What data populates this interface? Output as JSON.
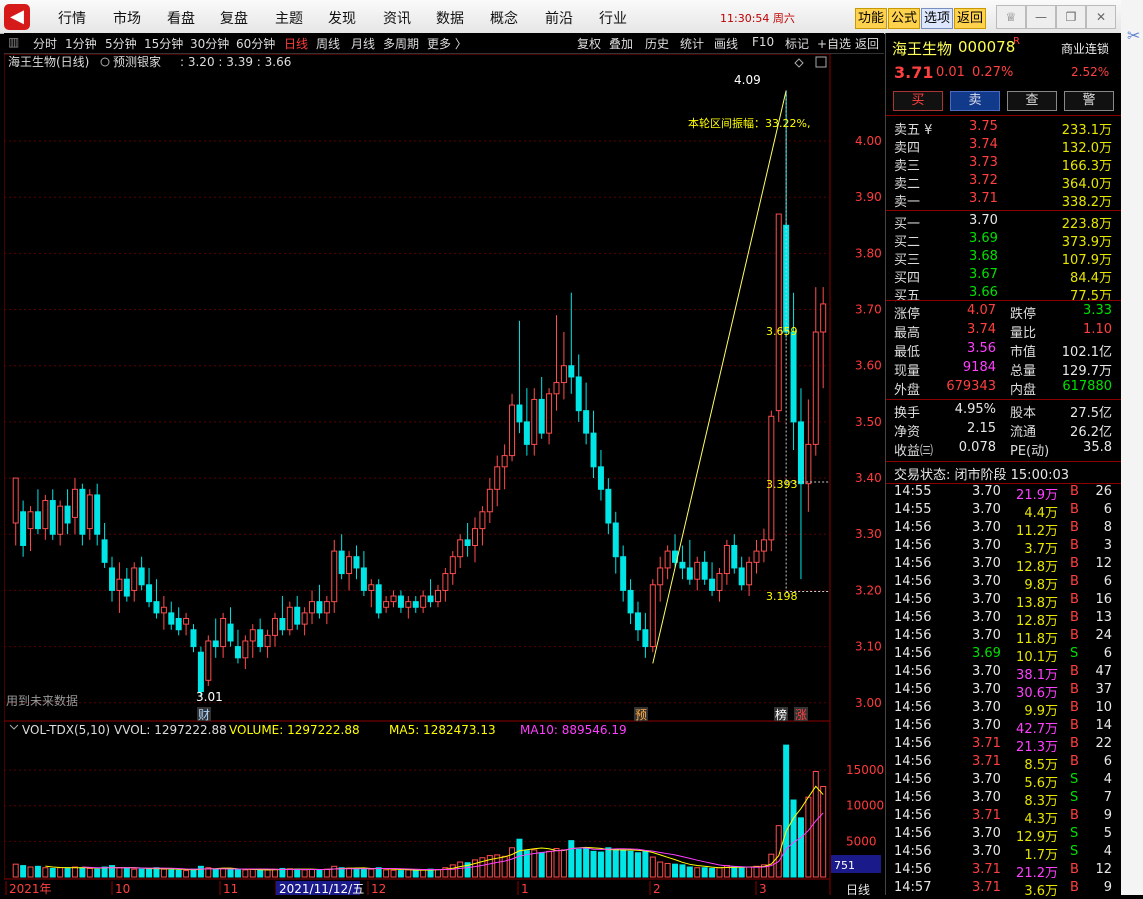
{
  "menu": [
    "行情",
    "市场",
    "看盘",
    "复盘",
    "主题",
    "发现",
    "资讯",
    "数据",
    "概念",
    "前沿",
    "行业"
  ],
  "clock": "11:30:54 周六",
  "sys_buttons": [
    "功能",
    "公式",
    "选项",
    "返回"
  ],
  "periods": [
    "分时",
    "1分钟",
    "5分钟",
    "15分钟",
    "30分钟",
    "60分钟",
    "日线",
    "周线",
    "月线",
    "多周期",
    "更多 〉"
  ],
  "active_period": "日线",
  "tools": [
    "复权",
    "叠加",
    "历史",
    "统计",
    "画线",
    "F10",
    "标记",
    "+自选",
    "返回"
  ],
  "chart_header": {
    "title": "海王生物(日线)",
    "indicator": "预测银家",
    "values": ": 3.20 : 3.39 : 3.66"
  },
  "annotations": {
    "high": "4.09",
    "amplitude": "本轮区间振幅：33.22%,",
    "mid1": "3.659",
    "mid2": "3.393",
    "low_mark": "3.198",
    "low_left": "3.01",
    "future_note": "用到未来数据",
    "marker_cai": "财",
    "marker_yu": "预",
    "marker_bang": "榜",
    "marker_zhang": "涨"
  },
  "volume_header": {
    "name": "VOL-TDX(5,10)",
    "vvol": "VVOL: 1297222.88",
    "volume": "VOLUME: 1297222.88",
    "ma5": "MA5: 1282473.13",
    "ma10": "MA10: 889546.19"
  },
  "volume_axis_extra": "751",
  "x_labels": [
    "2021年",
    "10",
    "11",
    "2021/11/12/五",
    "12",
    "1",
    "2",
    "3"
  ],
  "period_label": "日线",
  "stock": {
    "name": "海王生物",
    "code": "000078",
    "flag": "R",
    "tag": "商业连锁",
    "price": "3.71",
    "change": "0.01",
    "pct": "0.27%",
    "amp": "2.52%"
  },
  "trade_buttons": [
    "买",
    "卖",
    "查",
    "警"
  ],
  "asks": [
    [
      "卖五 ¥",
      "3.75",
      "233.1万"
    ],
    [
      "卖四",
      "3.74",
      "132.0万"
    ],
    [
      "卖三",
      "3.73",
      "166.3万"
    ],
    [
      "卖二",
      "3.72",
      "364.0万"
    ],
    [
      "卖一",
      "3.71",
      "338.2万"
    ]
  ],
  "bids": [
    [
      "买一",
      "3.70",
      "223.8万"
    ],
    [
      "买二",
      "3.69",
      "373.9万"
    ],
    [
      "买三",
      "3.68",
      "107.9万"
    ],
    [
      "买四",
      "3.67",
      "84.4万"
    ],
    [
      "买五",
      "3.66",
      "77.5万"
    ]
  ],
  "stats": [
    [
      "涨停",
      "4.07",
      "跌停",
      "3.33"
    ],
    [
      "最高",
      "3.74",
      "量比",
      "1.10"
    ],
    [
      "最低",
      "3.56",
      "市值",
      "102.1亿"
    ],
    [
      "现量",
      "9184",
      "总量",
      "129.7万"
    ],
    [
      "外盘",
      "679343",
      "内盘",
      "617880"
    ]
  ],
  "stats2": [
    [
      "换手",
      "4.95%",
      "股本",
      "27.5亿"
    ],
    [
      "净资",
      "2.15",
      "流通",
      "26.2亿"
    ],
    [
      "收益㈢",
      "0.078",
      "PE(动)",
      "35.8"
    ]
  ],
  "status": "交易状态: 闭市阶段 15:00:03",
  "ticks": [
    [
      "14:55",
      "3.70",
      "21.9万",
      "B",
      "26"
    ],
    [
      "14:55",
      "3.70",
      "4.4万",
      "B",
      "6"
    ],
    [
      "14:56",
      "3.70",
      "11.2万",
      "B",
      "8"
    ],
    [
      "14:56",
      "3.70",
      "3.7万",
      "B",
      "3"
    ],
    [
      "14:56",
      "3.70",
      "12.8万",
      "B",
      "12"
    ],
    [
      "14:56",
      "3.70",
      "9.8万",
      "B",
      "6"
    ],
    [
      "14:56",
      "3.70",
      "13.8万",
      "B",
      "16"
    ],
    [
      "14:56",
      "3.70",
      "12.8万",
      "B",
      "13"
    ],
    [
      "14:56",
      "3.70",
      "11.8万",
      "B",
      "24"
    ],
    [
      "14:56",
      "3.69",
      "10.1万",
      "S",
      "6"
    ],
    [
      "14:56",
      "3.70",
      "38.1万",
      "B",
      "47"
    ],
    [
      "14:56",
      "3.70",
      "30.6万",
      "B",
      "37"
    ],
    [
      "14:56",
      "3.70",
      "9.9万",
      "B",
      "10"
    ],
    [
      "14:56",
      "3.70",
      "42.7万",
      "B",
      "14"
    ],
    [
      "14:56",
      "3.71",
      "21.3万",
      "B",
      "22"
    ],
    [
      "14:56",
      "3.71",
      "8.5万",
      "B",
      "6"
    ],
    [
      "14:56",
      "3.70",
      "5.6万",
      "S",
      "4"
    ],
    [
      "14:56",
      "3.70",
      "8.3万",
      "S",
      "7"
    ],
    [
      "14:56",
      "3.71",
      "4.3万",
      "B",
      "9"
    ],
    [
      "14:56",
      "3.70",
      "12.9万",
      "S",
      "5"
    ],
    [
      "14:56",
      "3.70",
      "1.7万",
      "S",
      "4"
    ],
    [
      "14:56",
      "3.71",
      "21.2万",
      "B",
      "12"
    ],
    [
      "14:57",
      "3.71",
      "3.6万",
      "B",
      "9"
    ]
  ],
  "chart_data": {
    "type": "candlestick",
    "price_axis": [
      "4.00",
      "3.90",
      "3.80",
      "3.70",
      "3.60",
      "3.50",
      "3.40",
      "3.30",
      "3.20",
      "3.10",
      "3.00"
    ],
    "ylim": [
      2.98,
      4.13
    ],
    "volume_axis": [
      "15000",
      "10000",
      "5000"
    ],
    "vol_max": 19500,
    "candles": [
      [
        3.32,
        3.4,
        3.28,
        3.4
      ],
      [
        3.34,
        3.36,
        3.26,
        3.28
      ],
      [
        3.31,
        3.35,
        3.27,
        3.34
      ],
      [
        3.34,
        3.38,
        3.3,
        3.31
      ],
      [
        3.31,
        3.37,
        3.29,
        3.36
      ],
      [
        3.36,
        3.38,
        3.29,
        3.3
      ],
      [
        3.3,
        3.36,
        3.28,
        3.35
      ],
      [
        3.35,
        3.38,
        3.3,
        3.32
      ],
      [
        3.33,
        3.4,
        3.3,
        3.38
      ],
      [
        3.38,
        3.39,
        3.28,
        3.3
      ],
      [
        3.31,
        3.38,
        3.29,
        3.37
      ],
      [
        3.37,
        3.39,
        3.28,
        3.3
      ],
      [
        3.29,
        3.32,
        3.24,
        3.25
      ],
      [
        3.24,
        3.26,
        3.18,
        3.2
      ],
      [
        3.2,
        3.25,
        3.16,
        3.22
      ],
      [
        3.22,
        3.24,
        3.18,
        3.19
      ],
      [
        3.2,
        3.25,
        3.18,
        3.24
      ],
      [
        3.24,
        3.26,
        3.2,
        3.21
      ],
      [
        3.21,
        3.24,
        3.17,
        3.18
      ],
      [
        3.18,
        3.22,
        3.15,
        3.16
      ],
      [
        3.16,
        3.19,
        3.13,
        3.17
      ],
      [
        3.16,
        3.18,
        3.13,
        3.14
      ],
      [
        3.15,
        3.17,
        3.12,
        3.13
      ],
      [
        3.14,
        3.16,
        3.12,
        3.15
      ],
      [
        3.13,
        3.14,
        3.09,
        3.1
      ],
      [
        3.09,
        3.1,
        3.01,
        3.02
      ],
      [
        3.04,
        3.12,
        3.03,
        3.11
      ],
      [
        3.11,
        3.15,
        3.08,
        3.1
      ],
      [
        3.1,
        3.16,
        3.08,
        3.15
      ],
      [
        3.14,
        3.17,
        3.1,
        3.11
      ],
      [
        3.1,
        3.13,
        3.07,
        3.08
      ],
      [
        3.08,
        3.12,
        3.06,
        3.11
      ],
      [
        3.11,
        3.14,
        3.08,
        3.13
      ],
      [
        3.13,
        3.15,
        3.09,
        3.1
      ],
      [
        3.1,
        3.13,
        3.08,
        3.12
      ],
      [
        3.12,
        3.16,
        3.1,
        3.15
      ],
      [
        3.15,
        3.19,
        3.12,
        3.13
      ],
      [
        3.13,
        3.18,
        3.12,
        3.17
      ],
      [
        3.17,
        3.19,
        3.13,
        3.14
      ],
      [
        3.14,
        3.17,
        3.12,
        3.16
      ],
      [
        3.16,
        3.2,
        3.14,
        3.18
      ],
      [
        3.18,
        3.21,
        3.15,
        3.16
      ],
      [
        3.16,
        3.19,
        3.14,
        3.18
      ],
      [
        3.18,
        3.29,
        3.16,
        3.27
      ],
      [
        3.27,
        3.3,
        3.22,
        3.23
      ],
      [
        3.23,
        3.27,
        3.2,
        3.26
      ],
      [
        3.26,
        3.28,
        3.22,
        3.24
      ],
      [
        3.24,
        3.27,
        3.19,
        3.2
      ],
      [
        3.2,
        3.22,
        3.17,
        3.21
      ],
      [
        3.21,
        3.22,
        3.15,
        3.16
      ],
      [
        3.17,
        3.19,
        3.16,
        3.18
      ],
      [
        3.18,
        3.2,
        3.17,
        3.19
      ],
      [
        3.19,
        3.2,
        3.16,
        3.17
      ],
      [
        3.17,
        3.19,
        3.15,
        3.18
      ],
      [
        3.18,
        3.19,
        3.16,
        3.17
      ],
      [
        3.17,
        3.2,
        3.16,
        3.19
      ],
      [
        3.19,
        3.22,
        3.17,
        3.18
      ],
      [
        3.18,
        3.21,
        3.17,
        3.2
      ],
      [
        3.2,
        3.24,
        3.18,
        3.23
      ],
      [
        3.23,
        3.27,
        3.21,
        3.26
      ],
      [
        3.26,
        3.3,
        3.24,
        3.29
      ],
      [
        3.29,
        3.32,
        3.26,
        3.28
      ],
      [
        3.28,
        3.33,
        3.25,
        3.31
      ],
      [
        3.31,
        3.35,
        3.28,
        3.34
      ],
      [
        3.34,
        3.4,
        3.32,
        3.38
      ],
      [
        3.38,
        3.44,
        3.35,
        3.42
      ],
      [
        3.42,
        3.46,
        3.38,
        3.44
      ],
      [
        3.44,
        3.55,
        3.43,
        3.53
      ],
      [
        3.53,
        3.68,
        3.48,
        3.5
      ],
      [
        3.5,
        3.56,
        3.44,
        3.46
      ],
      [
        3.46,
        3.56,
        3.44,
        3.54
      ],
      [
        3.54,
        3.58,
        3.47,
        3.48
      ],
      [
        3.48,
        3.56,
        3.46,
        3.55
      ],
      [
        3.55,
        3.69,
        3.52,
        3.57
      ],
      [
        3.57,
        3.66,
        3.54,
        3.6
      ],
      [
        3.6,
        3.73,
        3.55,
        3.58
      ],
      [
        3.58,
        3.62,
        3.5,
        3.52
      ],
      [
        3.52,
        3.57,
        3.46,
        3.48
      ],
      [
        3.48,
        3.52,
        3.4,
        3.42
      ],
      [
        3.42,
        3.45,
        3.36,
        3.38
      ],
      [
        3.38,
        3.4,
        3.3,
        3.32
      ],
      [
        3.32,
        3.34,
        3.23,
        3.26
      ],
      [
        3.26,
        3.28,
        3.18,
        3.2
      ],
      [
        3.2,
        3.22,
        3.14,
        3.16
      ],
      [
        3.16,
        3.18,
        3.11,
        3.13
      ],
      [
        3.13,
        3.16,
        3.08,
        3.1
      ],
      [
        3.1,
        3.22,
        3.09,
        3.21
      ],
      [
        3.21,
        3.26,
        3.18,
        3.24
      ],
      [
        3.24,
        3.28,
        3.22,
        3.27
      ],
      [
        3.27,
        3.3,
        3.24,
        3.25
      ],
      [
        3.25,
        3.28,
        3.22,
        3.24
      ],
      [
        3.24,
        3.29,
        3.21,
        3.22
      ],
      [
        3.22,
        3.26,
        3.2,
        3.25
      ],
      [
        3.25,
        3.27,
        3.21,
        3.22
      ],
      [
        3.22,
        3.25,
        3.19,
        3.2
      ],
      [
        3.2,
        3.24,
        3.18,
        3.23
      ],
      [
        3.23,
        3.29,
        3.21,
        3.28
      ],
      [
        3.28,
        3.3,
        3.23,
        3.24
      ],
      [
        3.24,
        3.26,
        3.2,
        3.21
      ],
      [
        3.21,
        3.26,
        3.19,
        3.25
      ],
      [
        3.25,
        3.29,
        3.23,
        3.27
      ],
      [
        3.27,
        3.31,
        3.25,
        3.29
      ],
      [
        3.29,
        3.52,
        3.27,
        3.51
      ],
      [
        3.52,
        3.87,
        3.5,
        3.87
      ],
      [
        3.85,
        4.09,
        3.65,
        3.66
      ],
      [
        3.66,
        3.73,
        3.45,
        3.5
      ],
      [
        3.5,
        3.56,
        3.22,
        3.39
      ],
      [
        3.39,
        3.54,
        3.34,
        3.46
      ],
      [
        3.46,
        3.74,
        3.44,
        3.66
      ],
      [
        3.66,
        3.74,
        3.56,
        3.71
      ]
    ],
    "volumes": [
      1800,
      1600,
      1400,
      1500,
      1300,
      1200,
      1300,
      1250,
      1400,
      1300,
      1200,
      1100,
      1400,
      1600,
      1300,
      1200,
      1100,
      1100,
      1200,
      1300,
      1100,
      1000,
      950,
      900,
      1100,
      1500,
      1300,
      1100,
      1200,
      1100,
      1000,
      1000,
      1050,
      950,
      1000,
      1100,
      1200,
      1150,
      1100,
      1000,
      1050,
      1000,
      1100,
      1500,
      1300,
      1250,
      1200,
      1150,
      1100,
      1300,
      1000,
      950,
      900,
      1000,
      950,
      1000,
      1100,
      1050,
      1300,
      1700,
      2100,
      2000,
      2400,
      2700,
      3000,
      3100,
      2900,
      4100,
      5300,
      3700,
      3800,
      3400,
      3600,
      4000,
      3800,
      5100,
      3900,
      4000,
      3600,
      3500,
      4100,
      3900,
      3800,
      3600,
      3400,
      3600,
      2800,
      2100,
      1900,
      1800,
      1700,
      1400,
      1300,
      1300,
      1200,
      1300,
      1600,
      1400,
      1300,
      1400,
      1500,
      1700,
      3200,
      7200,
      18500,
      10800,
      8300,
      11200,
      14800,
      12700
    ]
  }
}
